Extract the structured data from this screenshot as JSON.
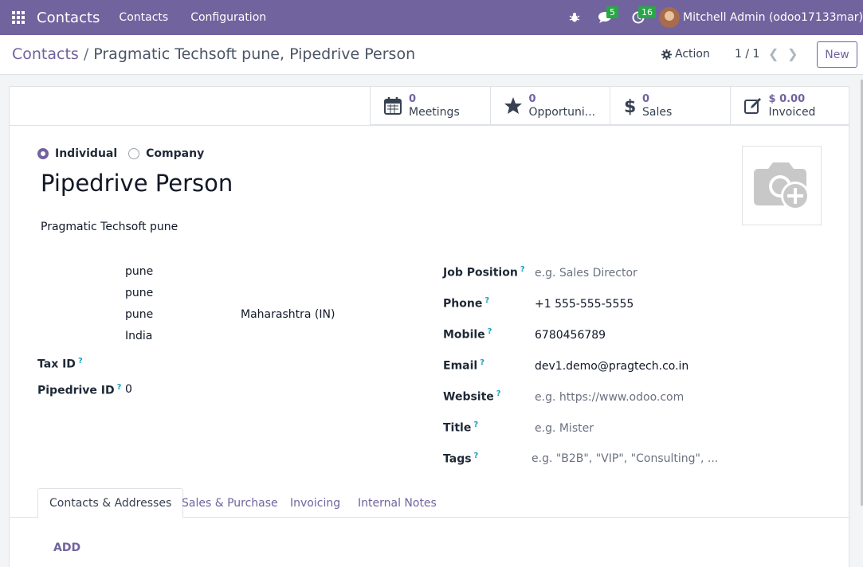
{
  "navbar": {
    "app_name": "Contacts",
    "menu": [
      "Contacts",
      "Configuration"
    ],
    "messages_count": "5",
    "activities_count": "16",
    "user": "Mitchell Admin (odoo17133mar)",
    "bg_color": "#71639e"
  },
  "control": {
    "breadcrumb_parent": "Contacts",
    "breadcrumb_separator": "/",
    "breadcrumb_current": "Pragmatic Techsoft pune, Pipedrive Person",
    "action_label": "Action",
    "pager": "1 / 1",
    "new_label": "New"
  },
  "smart_buttons": [
    {
      "icon": "calendar-icon",
      "value": "0",
      "label": "Meetings"
    },
    {
      "icon": "star-icon",
      "value": "0",
      "label": "Opportuni..."
    },
    {
      "icon": "dollar-icon",
      "value": "0",
      "label": "Sales"
    },
    {
      "icon": "invoice-edit-icon",
      "value": "$ 0.00",
      "label": "Invoiced"
    }
  ],
  "form": {
    "type_options": [
      {
        "label": "Individual",
        "selected": true
      },
      {
        "label": "Company",
        "selected": false
      }
    ],
    "name": "Pipedrive Person",
    "company": "Pragmatic Techsoft pune",
    "address": {
      "street": "pune",
      "street2": "pune",
      "city": "pune",
      "state": "Maharashtra (IN)",
      "country": "India"
    },
    "tax_id_label": "Tax ID",
    "pipedrive_id_label": "Pipedrive ID",
    "pipedrive_id_value": "0",
    "job_position_label": "Job Position",
    "job_position_placeholder": "e.g. Sales Director",
    "phone_label": "Phone",
    "phone_value": "+1 555-555-5555",
    "mobile_label": "Mobile",
    "mobile_value": "6780456789",
    "email_label": "Email",
    "email_value": "dev1.demo@pragtech.co.in",
    "website_label": "Website",
    "website_placeholder": "e.g. https://www.odoo.com",
    "title_label": "Title",
    "title_placeholder": "e.g. Mister",
    "tags_label": "Tags",
    "tags_placeholder": "e.g. \"B2B\", \"VIP\", \"Consulting\", ...",
    "help_marker": "?"
  },
  "tabs": [
    "Contacts & Addresses",
    "Sales & Purchase",
    "Invoicing",
    "Internal Notes"
  ],
  "active_tab": "Contacts & Addresses",
  "add_label": "ADD"
}
